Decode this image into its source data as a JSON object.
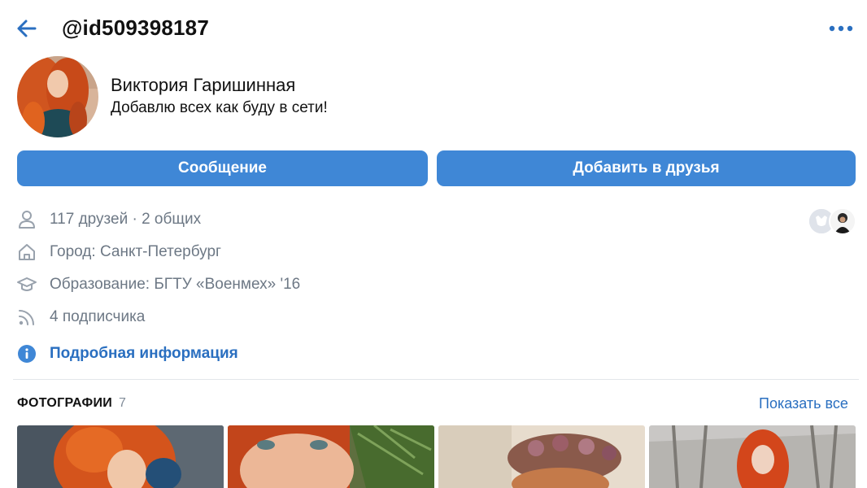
{
  "header": {
    "username": "@id509398187"
  },
  "profile": {
    "name": "Виктория Гаришинная",
    "status": "Добавлю всех как буду в сети!"
  },
  "actions": {
    "message_label": "Сообщение",
    "add_friend_label": "Добавить в друзья"
  },
  "info": {
    "friends": "117 друзей · 2 общих",
    "city": "Город: Санкт-Петербург",
    "education": "Образование: БГТУ «Военмех» '16",
    "followers": "4 подписчика",
    "details_link": "Подробная информация"
  },
  "photos": {
    "title": "ФОТОГРАФИИ",
    "count": "7",
    "show_all": "Показать все"
  },
  "colors": {
    "accent": "#3f87d6",
    "link": "#2a6fc0",
    "secondary_text": "#6d7885"
  },
  "icons": [
    "back-arrow-icon",
    "more-dots-icon",
    "person-icon",
    "home-icon",
    "graduation-cap-icon",
    "rss-icon",
    "info-icon"
  ]
}
